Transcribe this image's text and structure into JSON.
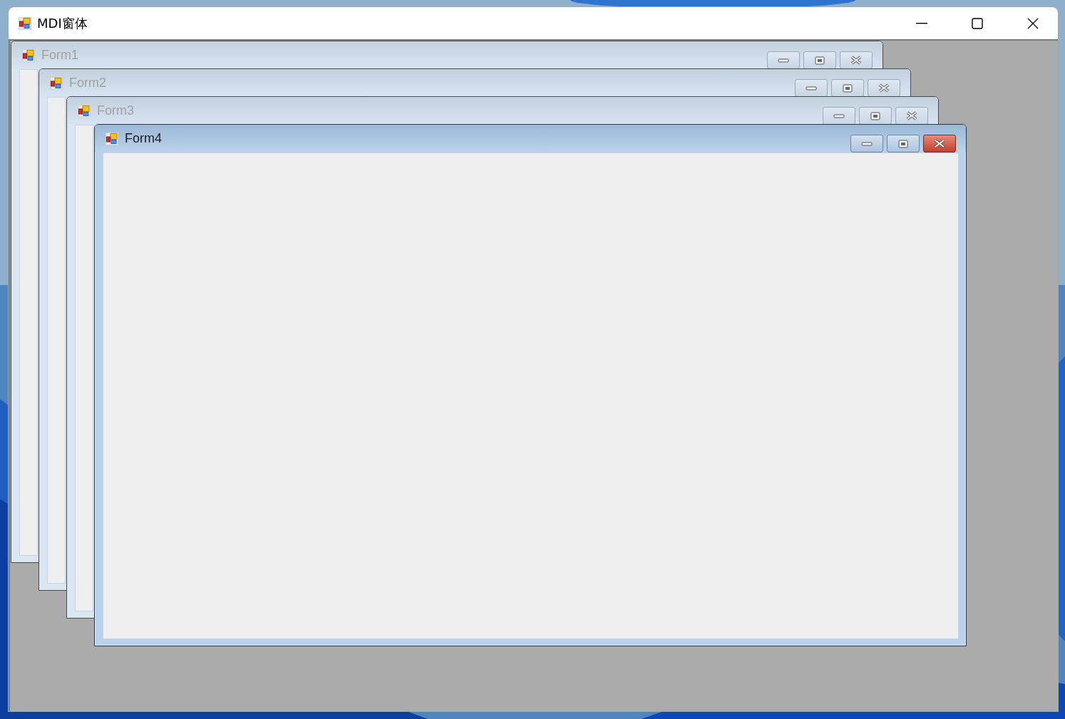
{
  "window": {
    "title": "MDI窗体"
  },
  "mdi_children": [
    {
      "title": "Form1",
      "selected": false
    },
    {
      "title": "Form2",
      "selected": false
    },
    {
      "title": "Form3",
      "selected": false
    },
    {
      "title": "Form4",
      "selected": true
    }
  ]
}
